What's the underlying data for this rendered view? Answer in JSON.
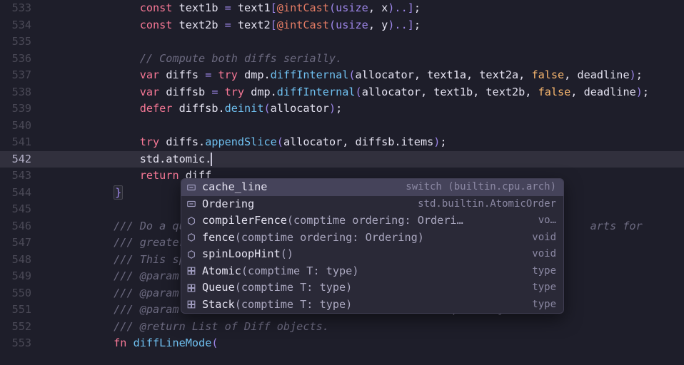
{
  "lines": [
    {
      "n": 533,
      "indent": 3,
      "tokens": [
        {
          "t": "keyword",
          "v": "const"
        },
        {
          "t": "ident",
          "v": " text1b "
        },
        {
          "t": "op",
          "v": "="
        },
        {
          "t": "ident",
          "v": " text1"
        },
        {
          "t": "op",
          "v": "["
        },
        {
          "t": "builtin",
          "v": "@intCast"
        },
        {
          "t": "op",
          "v": "("
        },
        {
          "t": "type",
          "v": "usize"
        },
        {
          "t": "ident",
          "v": ", x"
        },
        {
          "t": "op",
          "v": ")"
        },
        {
          "t": "op",
          "v": ".."
        },
        {
          "t": "op",
          "v": "]"
        },
        {
          "t": "ident",
          "v": ";"
        }
      ]
    },
    {
      "n": 534,
      "indent": 3,
      "tokens": [
        {
          "t": "keyword",
          "v": "const"
        },
        {
          "t": "ident",
          "v": " text2b "
        },
        {
          "t": "op",
          "v": "="
        },
        {
          "t": "ident",
          "v": " text2"
        },
        {
          "t": "op",
          "v": "["
        },
        {
          "t": "builtin",
          "v": "@intCast"
        },
        {
          "t": "op",
          "v": "("
        },
        {
          "t": "type",
          "v": "usize"
        },
        {
          "t": "ident",
          "v": ", y"
        },
        {
          "t": "op",
          "v": ")"
        },
        {
          "t": "op",
          "v": ".."
        },
        {
          "t": "op",
          "v": "]"
        },
        {
          "t": "ident",
          "v": ";"
        }
      ]
    },
    {
      "n": 535,
      "indent": 0,
      "tokens": []
    },
    {
      "n": 536,
      "indent": 3,
      "tokens": [
        {
          "t": "comment",
          "v": "// Compute both diffs serially."
        }
      ]
    },
    {
      "n": 537,
      "indent": 3,
      "tokens": [
        {
          "t": "keyword",
          "v": "var"
        },
        {
          "t": "ident",
          "v": " diffs "
        },
        {
          "t": "op",
          "v": "="
        },
        {
          "t": "ident",
          "v": " "
        },
        {
          "t": "keyword",
          "v": "try"
        },
        {
          "t": "ident",
          "v": " dmp."
        },
        {
          "t": "func",
          "v": "diffInternal"
        },
        {
          "t": "op",
          "v": "("
        },
        {
          "t": "ident",
          "v": "allocator, text1a, text2a, "
        },
        {
          "t": "bool",
          "v": "false"
        },
        {
          "t": "ident",
          "v": ", deadline"
        },
        {
          "t": "op",
          "v": ")"
        },
        {
          "t": "ident",
          "v": ";"
        }
      ]
    },
    {
      "n": 538,
      "indent": 3,
      "tokens": [
        {
          "t": "keyword",
          "v": "var"
        },
        {
          "t": "ident",
          "v": " diffsb "
        },
        {
          "t": "op",
          "v": "="
        },
        {
          "t": "ident",
          "v": " "
        },
        {
          "t": "keyword",
          "v": "try"
        },
        {
          "t": "ident",
          "v": " dmp."
        },
        {
          "t": "func",
          "v": "diffInternal"
        },
        {
          "t": "op",
          "v": "("
        },
        {
          "t": "ident",
          "v": "allocator, text1b, text2b, "
        },
        {
          "t": "bool",
          "v": "false"
        },
        {
          "t": "ident",
          "v": ", deadline"
        },
        {
          "t": "op",
          "v": ")"
        },
        {
          "t": "ident",
          "v": ";"
        }
      ]
    },
    {
      "n": 539,
      "indent": 3,
      "tokens": [
        {
          "t": "keyword",
          "v": "defer"
        },
        {
          "t": "ident",
          "v": " diffsb."
        },
        {
          "t": "func",
          "v": "deinit"
        },
        {
          "t": "op",
          "v": "("
        },
        {
          "t": "ident",
          "v": "allocator"
        },
        {
          "t": "op",
          "v": ")"
        },
        {
          "t": "ident",
          "v": ";"
        }
      ]
    },
    {
      "n": 540,
      "indent": 0,
      "tokens": []
    },
    {
      "n": 541,
      "indent": 3,
      "tokens": [
        {
          "t": "keyword",
          "v": "try"
        },
        {
          "t": "ident",
          "v": " diffs."
        },
        {
          "t": "func",
          "v": "appendSlice"
        },
        {
          "t": "op",
          "v": "("
        },
        {
          "t": "ident",
          "v": "allocator, diffsb.items"
        },
        {
          "t": "op",
          "v": ")"
        },
        {
          "t": "ident",
          "v": ";"
        }
      ]
    },
    {
      "n": 542,
      "indent": 3,
      "active": true,
      "cursor": true,
      "tokens": [
        {
          "t": "ident",
          "v": "std.atomic."
        }
      ]
    },
    {
      "n": 543,
      "indent": 3,
      "tokens": [
        {
          "t": "keyword",
          "v": "return"
        },
        {
          "t": "ident",
          "v": " diff"
        }
      ]
    },
    {
      "n": 544,
      "indent": 2,
      "tokens": [
        {
          "t": "op",
          "v": "}",
          "brace": true
        }
      ]
    },
    {
      "n": 545,
      "indent": 0,
      "tokens": []
    },
    {
      "n": 546,
      "indent": 2,
      "tokens": [
        {
          "t": "doc",
          "v": "/// Do a quick "
        },
        {
          "t": "doc",
          "v": "                                                          arts for"
        }
      ]
    },
    {
      "n": 547,
      "indent": 2,
      "tokens": [
        {
          "t": "doc",
          "v": "/// greater acc"
        }
      ]
    },
    {
      "n": 548,
      "indent": 2,
      "tokens": [
        {
          "t": "doc",
          "v": "/// This speedu"
        }
      ]
    },
    {
      "n": 549,
      "indent": 2,
      "tokens": [
        {
          "t": "doc",
          "v": "/// @param text"
        }
      ]
    },
    {
      "n": 550,
      "indent": 2,
      "tokens": [
        {
          "t": "doc",
          "v": "/// @param text"
        }
      ]
    },
    {
      "n": 551,
      "indent": 2,
      "tokens": [
        {
          "t": "doc",
          "v": "/// @param deadline Time when the diff should be complete by."
        }
      ]
    },
    {
      "n": 552,
      "indent": 2,
      "tokens": [
        {
          "t": "doc",
          "v": "/// @return List of Diff objects."
        }
      ]
    },
    {
      "n": 553,
      "indent": 2,
      "tokens": [
        {
          "t": "keyword",
          "v": "fn"
        },
        {
          "t": "ident",
          "v": " "
        },
        {
          "t": "func",
          "v": "diffLineMode"
        },
        {
          "t": "op",
          "v": "("
        }
      ]
    }
  ],
  "popup": {
    "items": [
      {
        "icon": "const",
        "name": "cache_line",
        "sig": "",
        "hint": "switch (builtin.cpu.arch)",
        "selected": true
      },
      {
        "icon": "const",
        "name": "Ordering",
        "sig": "",
        "hint": "std.builtin.AtomicOrder"
      },
      {
        "icon": "method",
        "name": "compilerFence",
        "sig": "(comptime ordering: Orderi…",
        "hint": "vo…"
      },
      {
        "icon": "method",
        "name": "fence",
        "sig": "(comptime ordering: Ordering)",
        "hint": "void"
      },
      {
        "icon": "method",
        "name": "spinLoopHint",
        "sig": "()",
        "hint": "void"
      },
      {
        "icon": "struct",
        "name": "Atomic",
        "sig": "(comptime T: type)",
        "hint": "type"
      },
      {
        "icon": "struct",
        "name": "Queue",
        "sig": "(comptime T: type)",
        "hint": "type"
      },
      {
        "icon": "struct",
        "name": "Stack",
        "sig": "(comptime T: type)",
        "hint": "type"
      }
    ]
  }
}
